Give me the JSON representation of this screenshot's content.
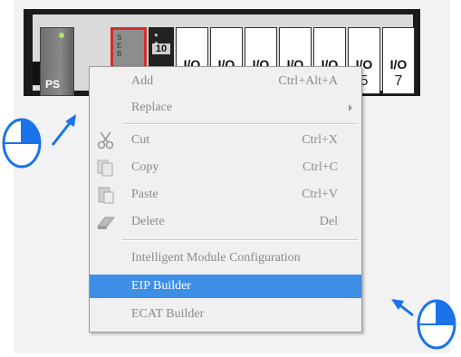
{
  "rack": {
    "ps_label": "PS",
    "cpu_label": "CP",
    "cpu_leds": [
      "S",
      "E",
      "B"
    ],
    "slot_number": "10",
    "io_modules": [
      {
        "label": "I/O",
        "number": ""
      },
      {
        "label": "I/O",
        "number": ""
      },
      {
        "label": "I/O",
        "number": ""
      },
      {
        "label": "I/O",
        "number": ""
      },
      {
        "label": "I/O",
        "number": ""
      },
      {
        "label": "I/O",
        "number": "5"
      },
      {
        "label": "I/O",
        "number": "7"
      }
    ]
  },
  "context_menu": {
    "items": [
      {
        "label": "Add",
        "shortcut": "Ctrl+Alt+A"
      },
      {
        "label": "Replace",
        "shortcut": ""
      },
      {
        "label": "Cut",
        "shortcut": "Ctrl+X"
      },
      {
        "label": "Copy",
        "shortcut": "Ctrl+C"
      },
      {
        "label": "Paste",
        "shortcut": "Ctrl+V"
      },
      {
        "label": "Delete",
        "shortcut": "Del"
      },
      {
        "label": "Intelligent Module Configuration",
        "shortcut": ""
      },
      {
        "label": "EIP Builder",
        "shortcut": ""
      },
      {
        "label": "ECAT Builder",
        "shortcut": ""
      }
    ],
    "highlight_color": "#3d8ee6"
  },
  "annotations": {
    "pointer_color": "#1a73e8",
    "icons": [
      "mouse-left-click-icon",
      "mouse-right-click-icon"
    ]
  }
}
